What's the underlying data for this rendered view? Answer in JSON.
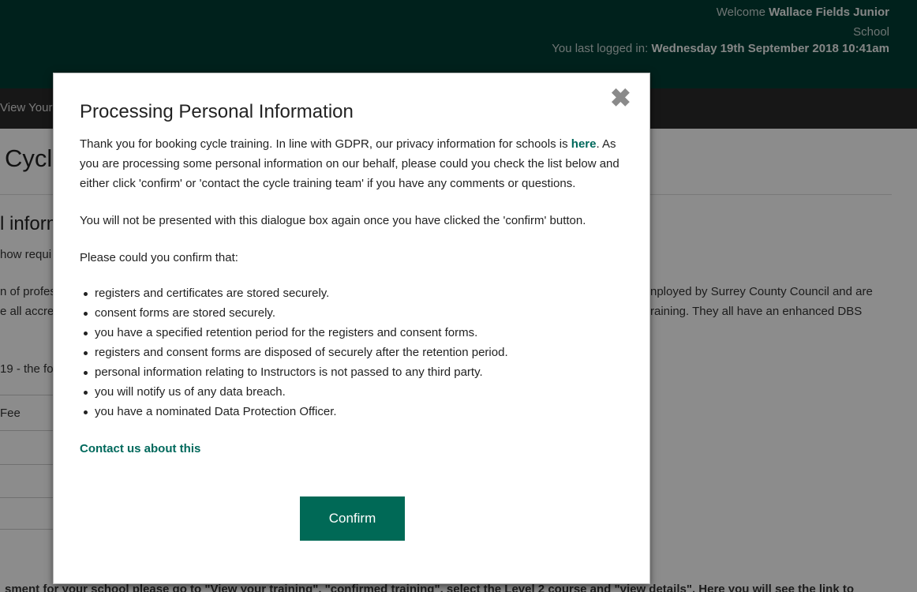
{
  "header": {
    "welcome_prefix": "Welcome",
    "school_name_line1": "Wallace Fields Junior",
    "school_name_line2": "School",
    "last_login_prefix": "You last logged in:",
    "last_login_value": "Wednesday 19th September 2018 10:41am"
  },
  "nav": {
    "item_partial": "View Your T"
  },
  "background": {
    "title_partial": "Cycl",
    "subtitle_partial": "l inform",
    "line1_partial": "how requi",
    "line2_left": "n of profes",
    "line2_right": "nployed by Surrey County Council and are",
    "line3_left": "e all accre",
    "line3_right": "raining. They all have an enhanced DBS",
    "line4_partial": "19 - the fo",
    "line5_partial": "Fee",
    "bottom_line": "sment for your school please go to \"View your training\", \"confirmed training\", select the Level 2 course and \"view details\". Here you will see the link to"
  },
  "modal": {
    "title": "Processing Personal Information",
    "close_symbol": "✖",
    "intro_text": "Thank you for booking cycle training. In line with GDPR, our privacy information for schools is ",
    "intro_link": "here",
    "intro_text_end": ". As you are processing some personal information on our behalf, please could you check the list below and either click 'confirm' or 'contact the cycle training team' if you have any comments or questions.",
    "notice": "You will not be presented with this dialogue box again once you have clicked the 'confirm' button.",
    "confirm_prompt": "Please could you confirm that:",
    "items": [
      "registers and certificates are stored securely.",
      "consent forms are stored securely.",
      "you have a specified retention period for the registers and consent forms.",
      "registers and consent forms are disposed of securely after the retention period.",
      "personal information relating to Instructors is not passed to any third party.",
      "you will notify us of any data breach.",
      "you have a nominated Data Protection Officer."
    ],
    "contact_link": "Contact us about this",
    "confirm_label": "Confirm"
  },
  "colors": {
    "header_bg": "#003c33",
    "nav_bg": "#2a2a2a",
    "accent": "#006956",
    "link": "#00695c"
  }
}
